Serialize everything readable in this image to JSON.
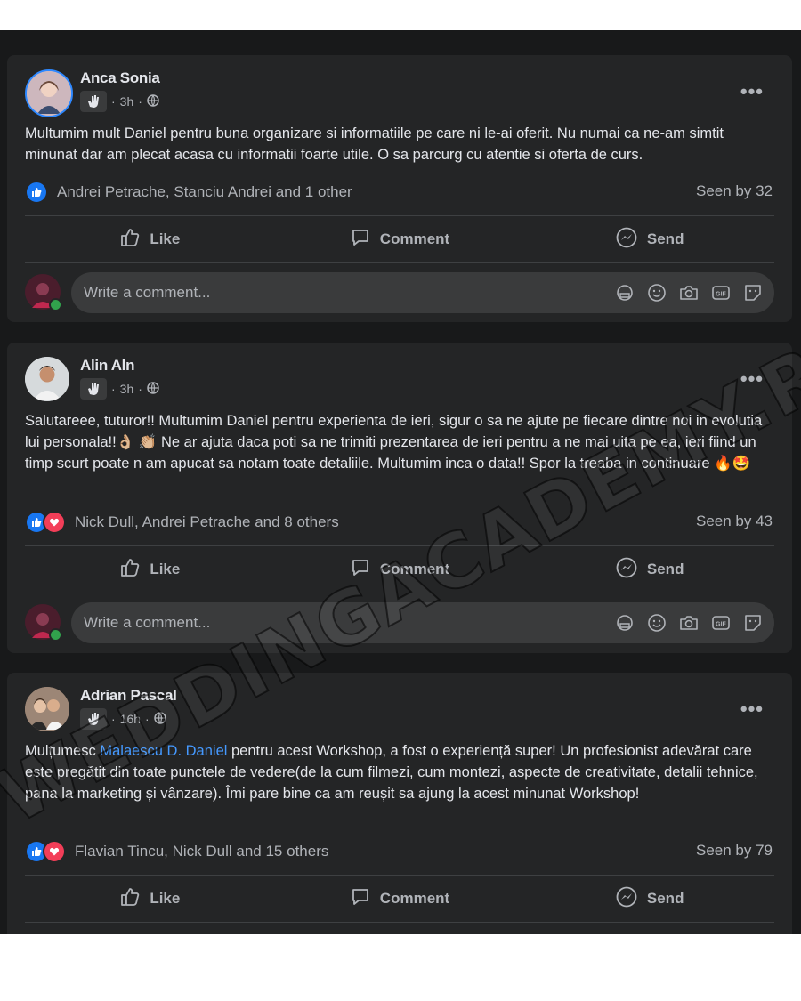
{
  "posts": [
    {
      "author": "Anca Sonia",
      "time": "3h",
      "text": "Multumim mult Daniel pentru buna organizare si informatiile pe care ni le-ai oferit. Nu numai ca ne-am simtit minunat dar am plecat acasa cu informatii foarte utile. O sa parcurg cu atentie si oferta de curs.",
      "reactions": "Andrei Petrache, Stanciu Andrei and 1 other",
      "seen": "Seen by 32"
    },
    {
      "author": "Alin Aln",
      "time": "3h",
      "text_before": "Salutareee, tuturor!! Multumim Daniel pentru experienta de ieri, sigur o sa ne ajute pe fiecare dintre noi in evolutia lui personala!!",
      "text_emoji1": "👌🏼 👏🏼",
      "text_after": " Ne ar ajuta daca poti sa ne trimiti prezentarea de ieri pentru a ne mai uita pe ea, ieri fiind un timp scurt poate n am apucat sa notam toate detaliile. Multumim inca o data!! Spor la treaba in continuare ",
      "text_emoji2": "🔥🤩",
      "reactions": "Nick Dull, Andrei Petrache and 8 others",
      "seen": "Seen by 43"
    },
    {
      "author": "Adrian Pascal",
      "time": "16h",
      "text_before": "Mulțumesc ",
      "mention": "Malaescu D. Daniel",
      "text_after": " pentru acest Workshop, a fost o experiență super! Un profesionist adevărat care este pregătit din toate punctele de vedere(de la cum filmezi, cum montezi, aspecte de creativitate, detalii tehnice, pana la marketing și vânzare). Îmi pare bine ca am reușit sa ajung la acest minunat Workshop!",
      "reactions": "Flavian Tincu, Nick Dull and 15 others",
      "seen": "Seen by 79"
    }
  ],
  "actions": {
    "like": "Like",
    "comment": "Comment",
    "send": "Send"
  },
  "comment_placeholder": "Write a comment...",
  "more_label": "•••",
  "watermark": "WEDDINGACADEMY.RO",
  "colors": {
    "like_blue": "#1877f2",
    "love_red": "#f33e58",
    "mention": "#4599ff"
  },
  "icons": [
    "like-icon",
    "comment-icon",
    "messenger-icon",
    "globe-icon",
    "wave-badge-icon",
    "sticker-icon",
    "emoji-icon",
    "camera-icon",
    "gif-icon",
    "avatar-sticker-icon"
  ]
}
